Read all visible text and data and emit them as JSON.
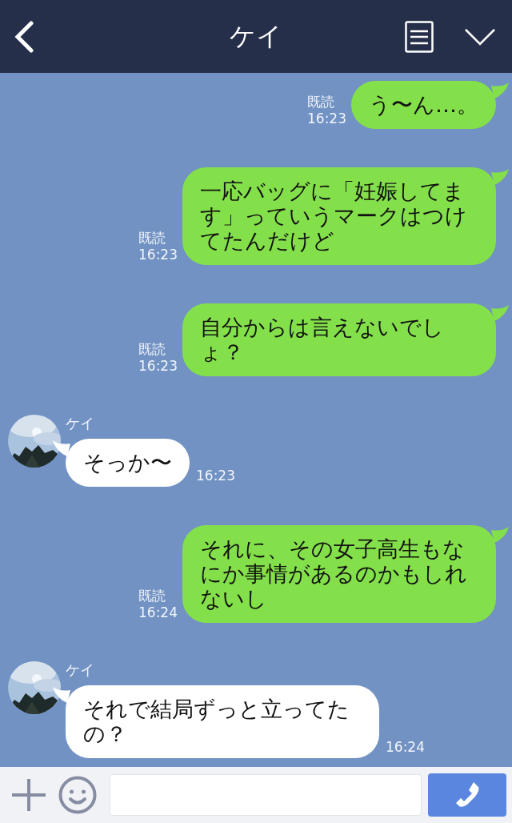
{
  "header": {
    "title": "ケイ"
  },
  "messages": [
    {
      "kind": "sent",
      "text": "う〜ん…。",
      "read": "既読",
      "time": "16:23"
    },
    {
      "kind": "sent",
      "text": "一応バッグに「妊娠してます」っていうマークはつけてたんだけど",
      "read": "既読",
      "time": "16:23"
    },
    {
      "kind": "sent",
      "text": "自分からは言えないでしょ？",
      "read": "既読",
      "time": "16:23"
    },
    {
      "kind": "received",
      "name": "ケイ",
      "text": "そっか〜",
      "time": "16:23"
    },
    {
      "kind": "sent",
      "text": "それに、その女子高生もなにか事情があるのかもしれないし",
      "read": "既読",
      "time": "16:24"
    },
    {
      "kind": "received",
      "name": "ケイ",
      "text": "それで結局ずっと立ってたの？",
      "time": "16:24"
    }
  ]
}
